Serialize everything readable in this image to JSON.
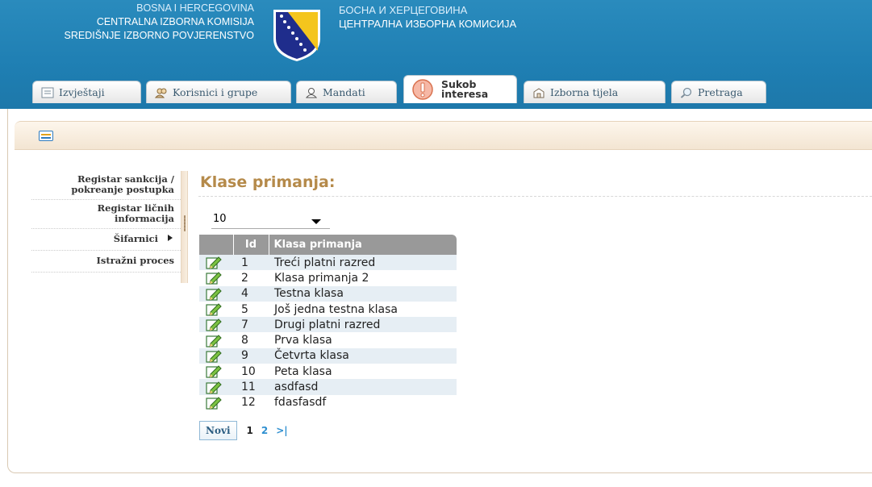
{
  "header": {
    "latin_lines": [
      "BOSNA I HERCEGOVINA",
      "CENTRALNA IZBORNA KOMISIJA",
      "SREDIŠNJE IZBORNO POVJERENSTVO"
    ],
    "cyrillic_lines": [
      "БОСНА И ХЕРЦЕГОВИНА",
      "ЦЕНТРАЛНА ИЗБОРНА КОМИСИЈА"
    ]
  },
  "tabs": [
    {
      "label": "Izvještaji",
      "icon": "report-icon"
    },
    {
      "label": "Korisnici i grupe",
      "icon": "users-icon"
    },
    {
      "label": "Mandati",
      "icon": "user-icon"
    },
    {
      "label_line1": "Sukob",
      "label_line2": "interesa",
      "icon": "warning-icon",
      "active": true
    },
    {
      "label": "Izborna tijela",
      "icon": "building-icon"
    },
    {
      "label": "Pretraga",
      "icon": "search-icon"
    }
  ],
  "sidebar": {
    "items": [
      {
        "label": "Registar sankcija / pokreanje postupka"
      },
      {
        "label": "Registar ličnih informacija"
      },
      {
        "label": "Šifarnici",
        "has_submenu": true
      },
      {
        "label": "Istražni proces"
      }
    ]
  },
  "main": {
    "title": "Klase primanja:",
    "page_size": "10",
    "columns": {
      "id": "Id",
      "name": "Klasa primanja"
    },
    "rows": [
      {
        "id": "1",
        "name": "Treći platni razred"
      },
      {
        "id": "2",
        "name": "Klasa primanja 2"
      },
      {
        "id": "4",
        "name": "Testna klasa"
      },
      {
        "id": "5",
        "name": "Još jedna testna klasa"
      },
      {
        "id": "7",
        "name": "Drugi platni razred"
      },
      {
        "id": "8",
        "name": "Prva klasa"
      },
      {
        "id": "9",
        "name": "Četvrta klasa"
      },
      {
        "id": "10",
        "name": "Peta klasa"
      },
      {
        "id": "11",
        "name": "asdfasd"
      },
      {
        "id": "12",
        "name": "fdasfasdf"
      }
    ],
    "pager": {
      "new_label": "Novi",
      "current": "1",
      "next": "2",
      "last": ">|"
    }
  },
  "colors": {
    "header_blue": "#1f7fb3",
    "title_tan": "#b58a4a",
    "link_blue": "#2e8fd0",
    "row_stripe": "#e6eef4"
  }
}
